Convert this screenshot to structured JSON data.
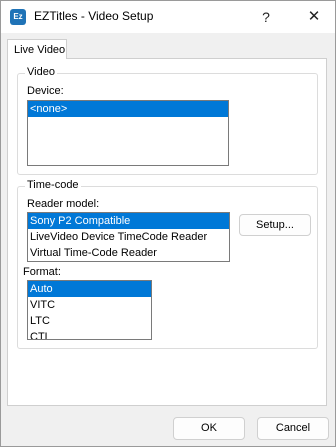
{
  "window": {
    "title": "EZTitles - Video Setup",
    "app_icon_text": "Ez",
    "help_glyph": "?",
    "close_glyph": "✕"
  },
  "tab": {
    "label": "Live Video"
  },
  "video": {
    "group_title": "Video",
    "device_label": "Device:",
    "devices": [
      "<none>"
    ]
  },
  "timecode": {
    "group_title": "Time-code",
    "reader_label": "Reader model:",
    "readers": [
      "Sony P2 Compatible",
      "LiveVideo Device TimeCode Reader",
      "Virtual Time-Code Reader"
    ],
    "setup_label": "Setup...",
    "format_label": "Format:",
    "formats": [
      "Auto",
      "VITC",
      "LTC",
      "CTL"
    ]
  },
  "buttons": {
    "ok": "OK",
    "cancel": "Cancel"
  },
  "colors": {
    "selection": "#0078d7"
  }
}
